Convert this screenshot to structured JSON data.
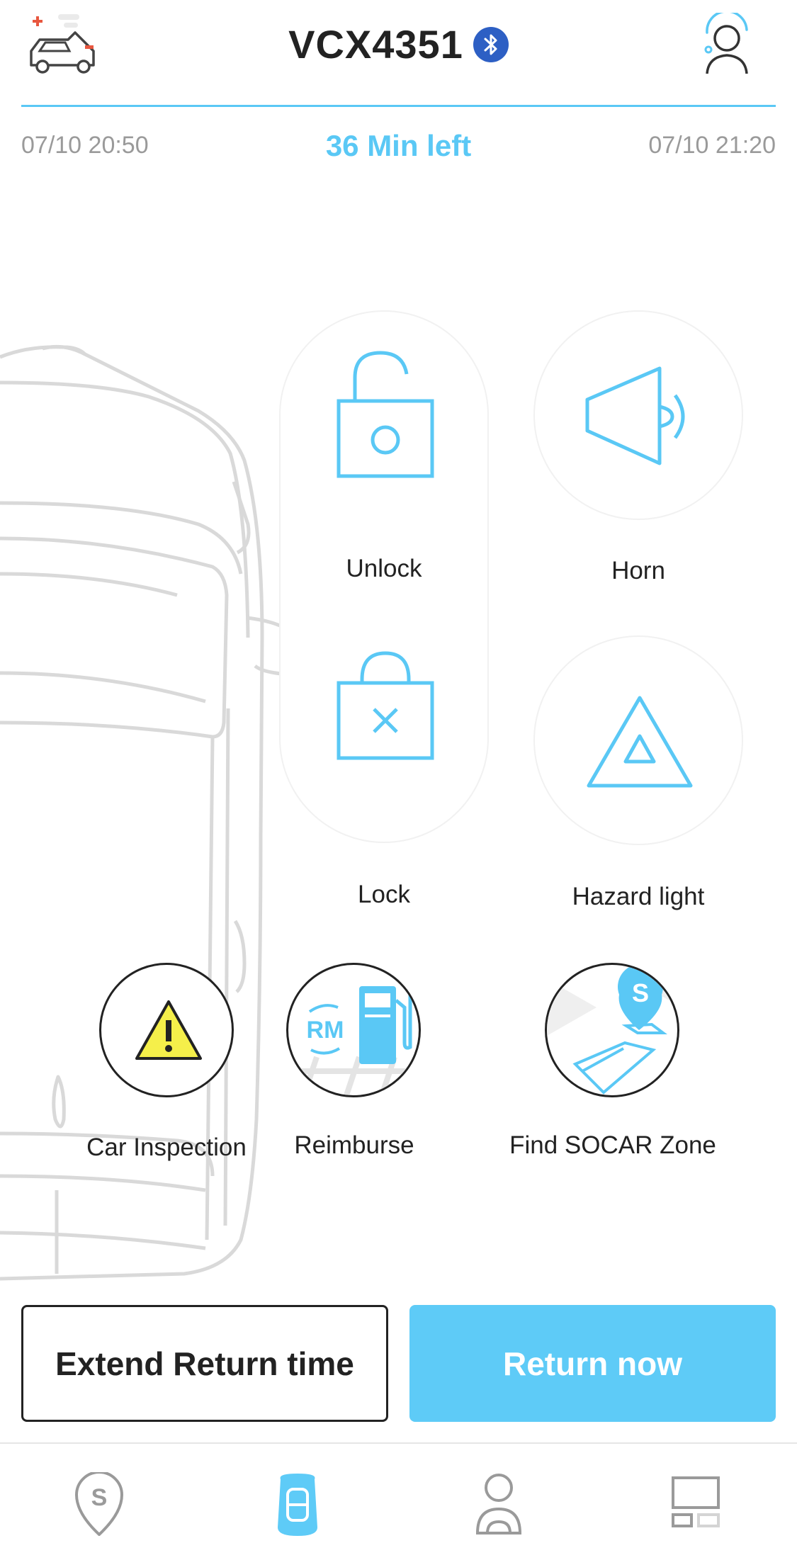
{
  "header": {
    "vehicle_plate": "VCX4351",
    "bluetooth_icon": "bluetooth-icon",
    "car_status_icon": "car-maintenance-icon",
    "support_icon": "customer-support-icon"
  },
  "rental": {
    "start_time": "07/10 20:50",
    "time_left": "36 Min left",
    "end_time": "07/10 21:20"
  },
  "controls": {
    "unlock_label": "Unlock",
    "horn_label": "Horn",
    "lock_label": "Lock",
    "hazard_label": "Hazard light"
  },
  "actions": {
    "inspection_label": "Car Inspection",
    "reimburse_label": "Reimburse",
    "reimburse_badge": "RM",
    "zone_label": "Find SOCAR Zone",
    "zone_badge": "S"
  },
  "buttons": {
    "extend_label": "Extend Return time",
    "return_label": "Return now"
  },
  "tab_bar": {
    "items": [
      "socar-home-icon",
      "smart-key-icon",
      "profile-icon",
      "dashboard-icon"
    ],
    "home_badge": "S",
    "active_index": 1
  },
  "colors": {
    "accent": "#5ac8f5",
    "button_primary": "#5ecbf7",
    "bluetooth": "#2d5fc4",
    "warning": "#f5ef4a"
  }
}
